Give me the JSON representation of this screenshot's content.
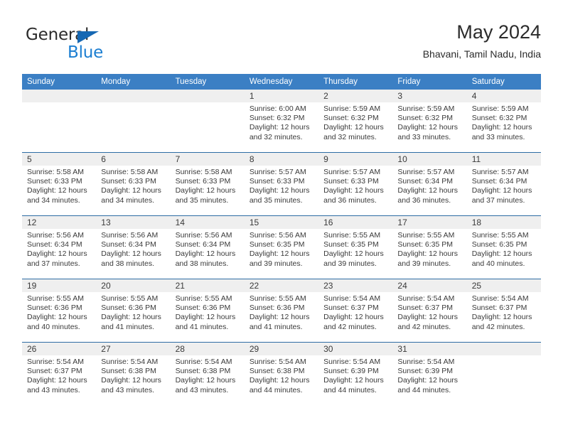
{
  "brand": {
    "name_part1": "General",
    "name_part2": "Blue",
    "triangle_icon": "triangle-icon",
    "accent_color": "#1b7ed1",
    "header_color": "#3b7fc4"
  },
  "header": {
    "title": "May 2024",
    "subtitle": "Bhavani, Tamil Nadu, India"
  },
  "calendar": {
    "weekday_headers": [
      "Sunday",
      "Monday",
      "Tuesday",
      "Wednesday",
      "Thursday",
      "Friday",
      "Saturday"
    ],
    "weeks": [
      [
        {
          "day": "",
          "sunrise": "",
          "sunset": "",
          "daylight1": "",
          "daylight2": ""
        },
        {
          "day": "",
          "sunrise": "",
          "sunset": "",
          "daylight1": "",
          "daylight2": ""
        },
        {
          "day": "",
          "sunrise": "",
          "sunset": "",
          "daylight1": "",
          "daylight2": ""
        },
        {
          "day": "1",
          "sunrise": "Sunrise: 6:00 AM",
          "sunset": "Sunset: 6:32 PM",
          "daylight1": "Daylight: 12 hours",
          "daylight2": "and 32 minutes."
        },
        {
          "day": "2",
          "sunrise": "Sunrise: 5:59 AM",
          "sunset": "Sunset: 6:32 PM",
          "daylight1": "Daylight: 12 hours",
          "daylight2": "and 32 minutes."
        },
        {
          "day": "3",
          "sunrise": "Sunrise: 5:59 AM",
          "sunset": "Sunset: 6:32 PM",
          "daylight1": "Daylight: 12 hours",
          "daylight2": "and 33 minutes."
        },
        {
          "day": "4",
          "sunrise": "Sunrise: 5:59 AM",
          "sunset": "Sunset: 6:32 PM",
          "daylight1": "Daylight: 12 hours",
          "daylight2": "and 33 minutes."
        }
      ],
      [
        {
          "day": "5",
          "sunrise": "Sunrise: 5:58 AM",
          "sunset": "Sunset: 6:33 PM",
          "daylight1": "Daylight: 12 hours",
          "daylight2": "and 34 minutes."
        },
        {
          "day": "6",
          "sunrise": "Sunrise: 5:58 AM",
          "sunset": "Sunset: 6:33 PM",
          "daylight1": "Daylight: 12 hours",
          "daylight2": "and 34 minutes."
        },
        {
          "day": "7",
          "sunrise": "Sunrise: 5:58 AM",
          "sunset": "Sunset: 6:33 PM",
          "daylight1": "Daylight: 12 hours",
          "daylight2": "and 35 minutes."
        },
        {
          "day": "8",
          "sunrise": "Sunrise: 5:57 AM",
          "sunset": "Sunset: 6:33 PM",
          "daylight1": "Daylight: 12 hours",
          "daylight2": "and 35 minutes."
        },
        {
          "day": "9",
          "sunrise": "Sunrise: 5:57 AM",
          "sunset": "Sunset: 6:33 PM",
          "daylight1": "Daylight: 12 hours",
          "daylight2": "and 36 minutes."
        },
        {
          "day": "10",
          "sunrise": "Sunrise: 5:57 AM",
          "sunset": "Sunset: 6:34 PM",
          "daylight1": "Daylight: 12 hours",
          "daylight2": "and 36 minutes."
        },
        {
          "day": "11",
          "sunrise": "Sunrise: 5:57 AM",
          "sunset": "Sunset: 6:34 PM",
          "daylight1": "Daylight: 12 hours",
          "daylight2": "and 37 minutes."
        }
      ],
      [
        {
          "day": "12",
          "sunrise": "Sunrise: 5:56 AM",
          "sunset": "Sunset: 6:34 PM",
          "daylight1": "Daylight: 12 hours",
          "daylight2": "and 37 minutes."
        },
        {
          "day": "13",
          "sunrise": "Sunrise: 5:56 AM",
          "sunset": "Sunset: 6:34 PM",
          "daylight1": "Daylight: 12 hours",
          "daylight2": "and 38 minutes."
        },
        {
          "day": "14",
          "sunrise": "Sunrise: 5:56 AM",
          "sunset": "Sunset: 6:34 PM",
          "daylight1": "Daylight: 12 hours",
          "daylight2": "and 38 minutes."
        },
        {
          "day": "15",
          "sunrise": "Sunrise: 5:56 AM",
          "sunset": "Sunset: 6:35 PM",
          "daylight1": "Daylight: 12 hours",
          "daylight2": "and 39 minutes."
        },
        {
          "day": "16",
          "sunrise": "Sunrise: 5:55 AM",
          "sunset": "Sunset: 6:35 PM",
          "daylight1": "Daylight: 12 hours",
          "daylight2": "and 39 minutes."
        },
        {
          "day": "17",
          "sunrise": "Sunrise: 5:55 AM",
          "sunset": "Sunset: 6:35 PM",
          "daylight1": "Daylight: 12 hours",
          "daylight2": "and 39 minutes."
        },
        {
          "day": "18",
          "sunrise": "Sunrise: 5:55 AM",
          "sunset": "Sunset: 6:35 PM",
          "daylight1": "Daylight: 12 hours",
          "daylight2": "and 40 minutes."
        }
      ],
      [
        {
          "day": "19",
          "sunrise": "Sunrise: 5:55 AM",
          "sunset": "Sunset: 6:36 PM",
          "daylight1": "Daylight: 12 hours",
          "daylight2": "and 40 minutes."
        },
        {
          "day": "20",
          "sunrise": "Sunrise: 5:55 AM",
          "sunset": "Sunset: 6:36 PM",
          "daylight1": "Daylight: 12 hours",
          "daylight2": "and 41 minutes."
        },
        {
          "day": "21",
          "sunrise": "Sunrise: 5:55 AM",
          "sunset": "Sunset: 6:36 PM",
          "daylight1": "Daylight: 12 hours",
          "daylight2": "and 41 minutes."
        },
        {
          "day": "22",
          "sunrise": "Sunrise: 5:55 AM",
          "sunset": "Sunset: 6:36 PM",
          "daylight1": "Daylight: 12 hours",
          "daylight2": "and 41 minutes."
        },
        {
          "day": "23",
          "sunrise": "Sunrise: 5:54 AM",
          "sunset": "Sunset: 6:37 PM",
          "daylight1": "Daylight: 12 hours",
          "daylight2": "and 42 minutes."
        },
        {
          "day": "24",
          "sunrise": "Sunrise: 5:54 AM",
          "sunset": "Sunset: 6:37 PM",
          "daylight1": "Daylight: 12 hours",
          "daylight2": "and 42 minutes."
        },
        {
          "day": "25",
          "sunrise": "Sunrise: 5:54 AM",
          "sunset": "Sunset: 6:37 PM",
          "daylight1": "Daylight: 12 hours",
          "daylight2": "and 42 minutes."
        }
      ],
      [
        {
          "day": "26",
          "sunrise": "Sunrise: 5:54 AM",
          "sunset": "Sunset: 6:37 PM",
          "daylight1": "Daylight: 12 hours",
          "daylight2": "and 43 minutes."
        },
        {
          "day": "27",
          "sunrise": "Sunrise: 5:54 AM",
          "sunset": "Sunset: 6:38 PM",
          "daylight1": "Daylight: 12 hours",
          "daylight2": "and 43 minutes."
        },
        {
          "day": "28",
          "sunrise": "Sunrise: 5:54 AM",
          "sunset": "Sunset: 6:38 PM",
          "daylight1": "Daylight: 12 hours",
          "daylight2": "and 43 minutes."
        },
        {
          "day": "29",
          "sunrise": "Sunrise: 5:54 AM",
          "sunset": "Sunset: 6:38 PM",
          "daylight1": "Daylight: 12 hours",
          "daylight2": "and 44 minutes."
        },
        {
          "day": "30",
          "sunrise": "Sunrise: 5:54 AM",
          "sunset": "Sunset: 6:39 PM",
          "daylight1": "Daylight: 12 hours",
          "daylight2": "and 44 minutes."
        },
        {
          "day": "31",
          "sunrise": "Sunrise: 5:54 AM",
          "sunset": "Sunset: 6:39 PM",
          "daylight1": "Daylight: 12 hours",
          "daylight2": "and 44 minutes."
        },
        {
          "day": "",
          "sunrise": "",
          "sunset": "",
          "daylight1": "",
          "daylight2": ""
        }
      ]
    ]
  }
}
